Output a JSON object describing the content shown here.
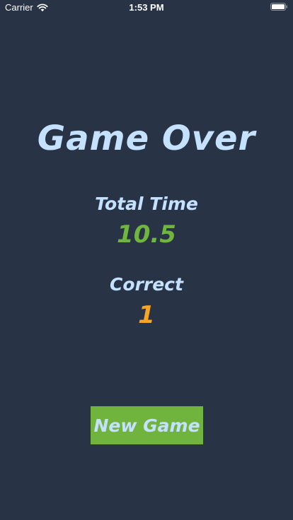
{
  "status_bar": {
    "carrier": "Carrier",
    "time": "1:53 PM",
    "icons": [
      "wifi-icon",
      "battery-icon"
    ]
  },
  "game_over": {
    "title": "Game Over",
    "total_time_label": "Total Time",
    "total_time_value": "10.5",
    "correct_label": "Correct",
    "correct_value": "1",
    "new_game_label": "New Game"
  },
  "colors": {
    "background": "#283346",
    "text": "#c4e2ff",
    "time_value": "#6fb53e",
    "correct_value": "#f6a623",
    "button": "#70b33d"
  }
}
